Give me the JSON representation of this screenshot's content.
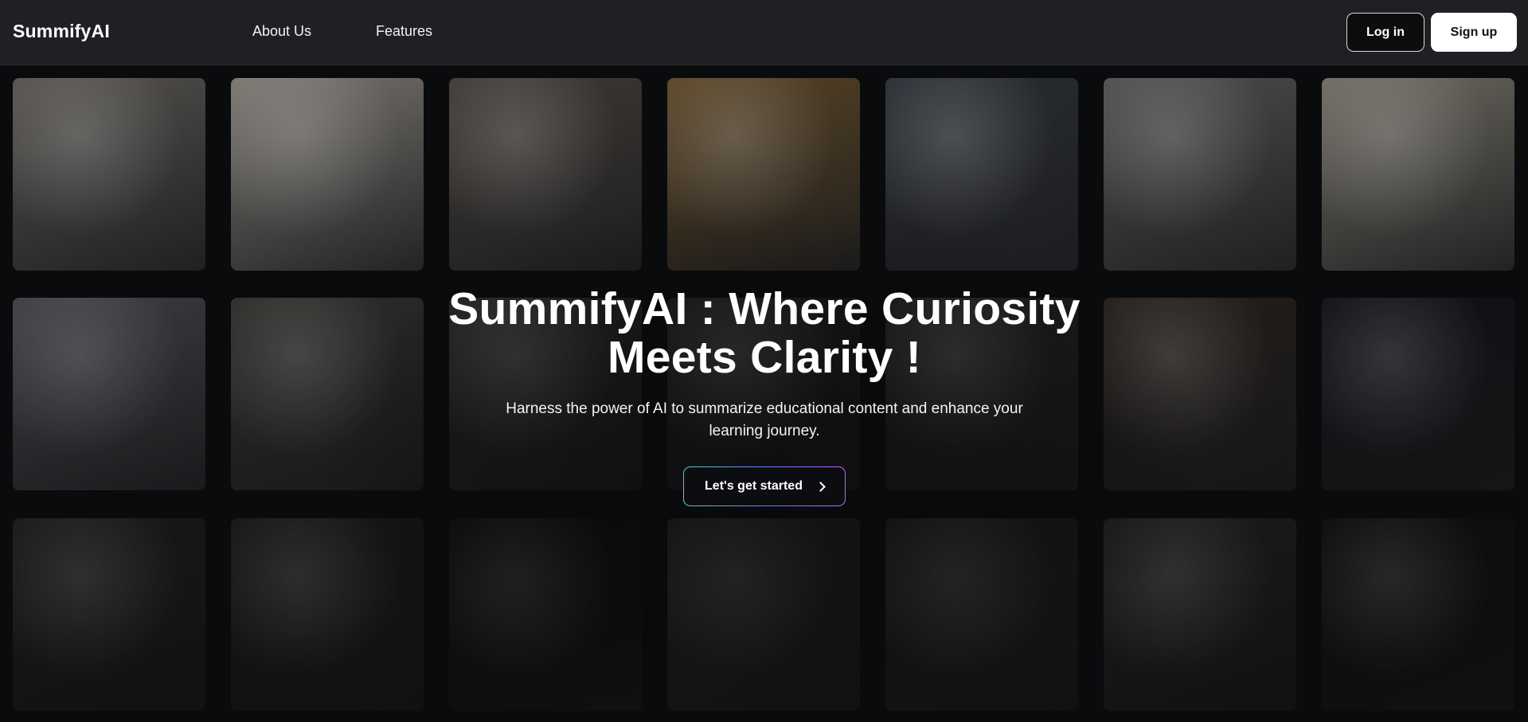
{
  "nav": {
    "logo": "SummifyAI",
    "links": [
      "About Us",
      "Features"
    ],
    "login": "Log in",
    "signup": "Sign up"
  },
  "hero": {
    "title_line1": "SummifyAI : Where Curiosity",
    "title_line2": "Meets Clarity !",
    "subtitle": "Harness the power of AI to summarize educational content and enhance your learning journey.",
    "cta": "Let's get started",
    "cta_icon": "chevron-right-icon"
  },
  "tiles": [
    {
      "row": 0,
      "col": 0,
      "label": "woman-at-laptop-window",
      "tone": "#55524e"
    },
    {
      "row": 0,
      "col": 1,
      "label": "laptop-desk-woman",
      "tone": "#7a7670"
    },
    {
      "row": 0,
      "col": 2,
      "label": "students-laughing-table",
      "tone": "#3f3a35"
    },
    {
      "row": 0,
      "col": 3,
      "label": "person-yellow-sweater-laptop",
      "tone": "#5a4425"
    },
    {
      "row": 0,
      "col": 4,
      "label": "people-meeting-laptop",
      "tone": "#2a2d33"
    },
    {
      "row": 0,
      "col": 5,
      "label": "passion-led-us-here-pavement",
      "tone": "#4d4e50"
    },
    {
      "row": 0,
      "col": 6,
      "label": "overhead-desk-laptops",
      "tone": "#6e6a61"
    },
    {
      "row": 1,
      "col": 0,
      "label": "hands-laptop-notebook",
      "tone": "#4c4e52"
    },
    {
      "row": 1,
      "col": 1,
      "label": "overhead-workspace",
      "tone": "#3a3835"
    },
    {
      "row": 1,
      "col": 2,
      "label": "chalkboard-emc2",
      "tone": "#26282a"
    },
    {
      "row": 1,
      "col": 3,
      "label": "laptop-typing",
      "tone": "#1d1e20"
    },
    {
      "row": 1,
      "col": 4,
      "label": "classroom",
      "tone": "#24221f"
    },
    {
      "row": 1,
      "col": 5,
      "label": "laptop-on-wooden-desk",
      "tone": "#2b2520"
    },
    {
      "row": 1,
      "col": 6,
      "label": "code-on-screen",
      "tone": "#15161b"
    },
    {
      "row": 2,
      "col": 0,
      "label": "laptop-on-table-overhead",
      "tone": "#2a2928"
    },
    {
      "row": 2,
      "col": 1,
      "label": "laptop-code-dark",
      "tone": "#232425"
    },
    {
      "row": 2,
      "col": 2,
      "label": "do-something-great-neon",
      "tone": "#121314"
    },
    {
      "row": 2,
      "col": 3,
      "label": "hands-typing-plant",
      "tone": "#2f2e2c"
    },
    {
      "row": 2,
      "col": 4,
      "label": "typing-keyboard",
      "tone": "#262727"
    },
    {
      "row": 2,
      "col": 5,
      "label": "white-keyboard",
      "tone": "#2b2c2d"
    },
    {
      "row": 2,
      "col": 6,
      "label": "code-screen-dark",
      "tone": "#141518"
    }
  ]
}
